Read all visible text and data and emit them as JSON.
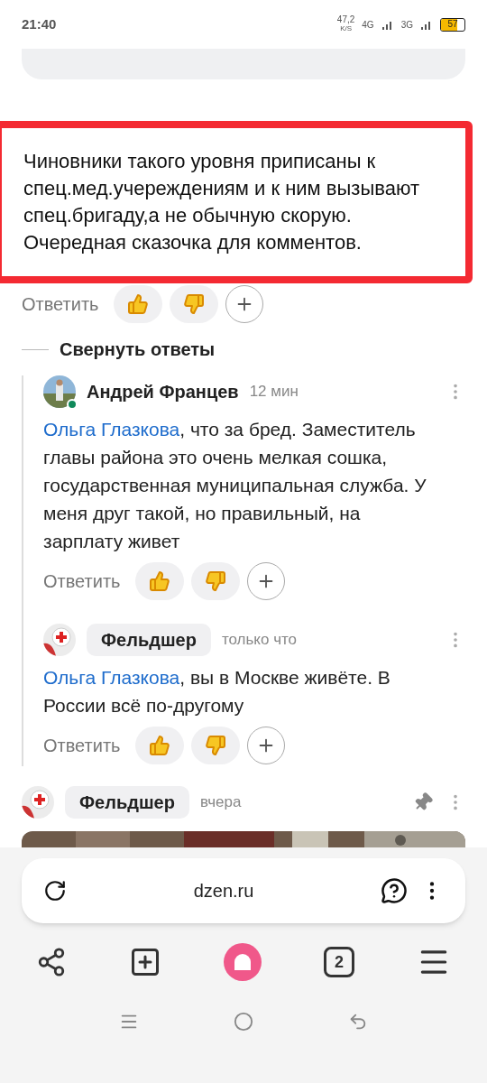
{
  "status_bar": {
    "time": "21:40",
    "net_speed": "47,2",
    "net_unit": "K/S",
    "network_1": "4G",
    "network_2": "3G",
    "battery": "57"
  },
  "highlighted_comment": {
    "text": "Чиновники такого уровня приписаны к спец.мед.учереждениям и к ним вызывают спец.бригаду,а не обычную скорую. Очередная сказочка для комментов.",
    "reply_label": "Ответить"
  },
  "collapse_replies": "Свернуть ответы",
  "replies": [
    {
      "online": true,
      "author_pill": false,
      "author": "Андрей Францев",
      "time": "12 мин",
      "mention": "Ольга Глазкова",
      "text": ", что за бред. Заместитель главы района это очень мелкая сошка, государственная муниципальная служба. У меня друг такой, но правильный, на зарплату живет",
      "reply_label": "Ответить"
    },
    {
      "avatar": {
        "kind": "red_cross"
      },
      "online": false,
      "author_pill": true,
      "author": "Фельдшер",
      "time": "только что",
      "mention": "Ольга Глазкова",
      "text": ", вы в Москве живёте. В России всё по-другому",
      "reply_label": "Ответить"
    }
  ],
  "next_comment": {
    "avatar": {
      "kind": "red_cross"
    },
    "author_pill": true,
    "author": "Фельдшер",
    "time": "вчера",
    "pinned": true
  },
  "address_bar": {
    "url": "dzen.ru"
  },
  "toolbar": {
    "tabs_count": "2"
  }
}
